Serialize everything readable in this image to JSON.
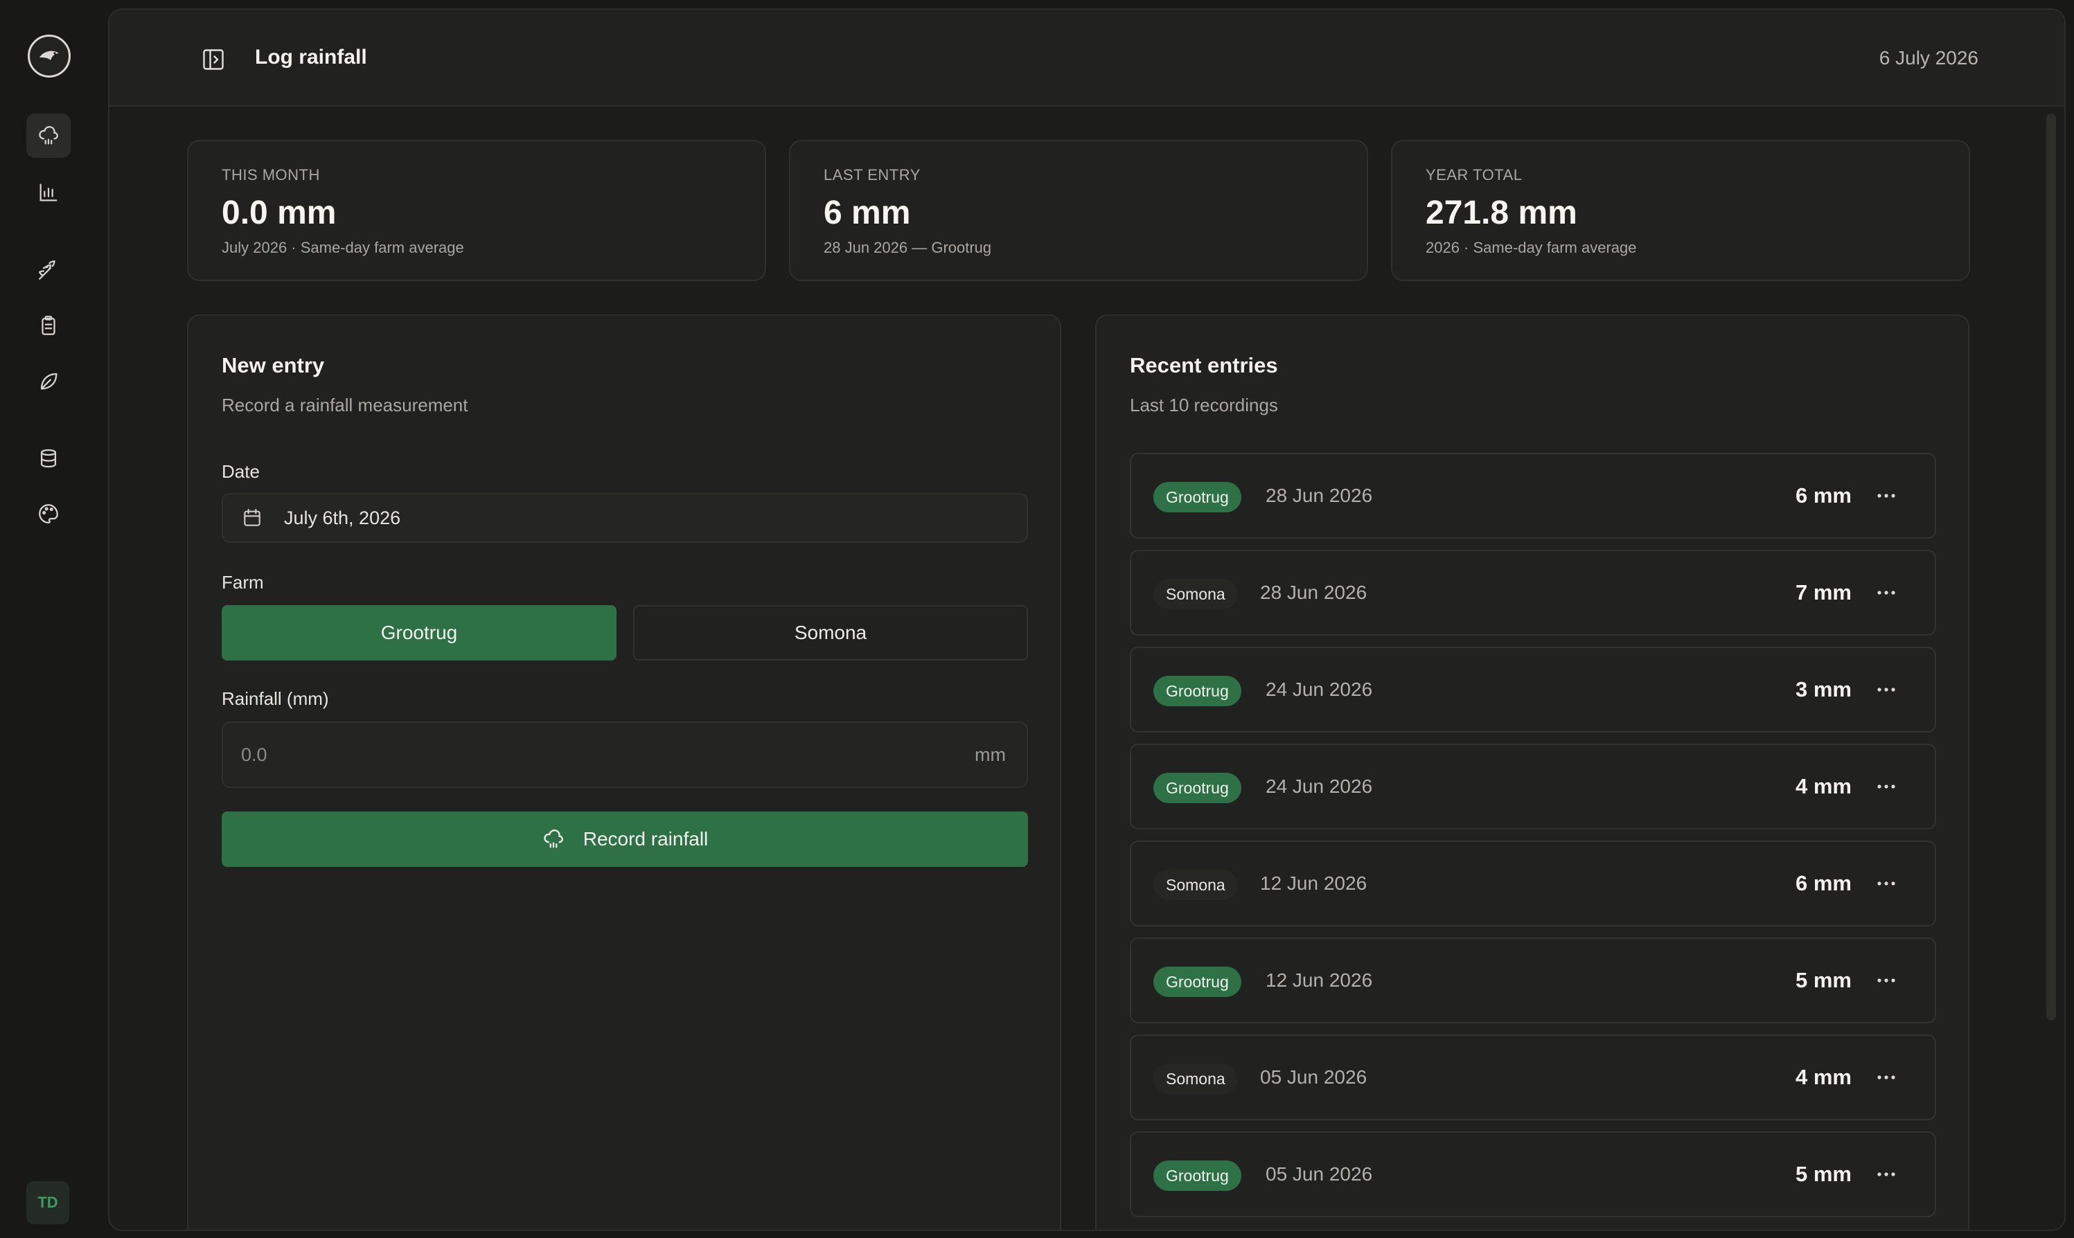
{
  "header": {
    "title": "Log rainfall",
    "date": "6 July 2026"
  },
  "user": {
    "initials": "TD"
  },
  "nav_icons": [
    "cloud-rain-icon",
    "bar-chart-icon",
    "wheat-icon",
    "clipboard-icon",
    "leaf-icon",
    "database-icon",
    "palette-icon"
  ],
  "stats": [
    {
      "label": "THIS MONTH",
      "value": "0.0 mm",
      "sub": "July 2026 · Same-day farm average"
    },
    {
      "label": "LAST ENTRY",
      "value": "6 mm",
      "sub": "28 Jun 2026 — Grootrug"
    },
    {
      "label": "YEAR TOTAL",
      "value": "271.8 mm",
      "sub": "2026 · Same-day farm average"
    }
  ],
  "new_entry": {
    "title": "New entry",
    "subtitle": "Record a rainfall measurement",
    "date_label": "Date",
    "date_value": "July 6th, 2026",
    "farm_label": "Farm",
    "farms": [
      "Grootrug",
      "Somona"
    ],
    "selected_farm": "Grootrug",
    "rain_label": "Rainfall (mm)",
    "rain_placeholder": "0.0",
    "rain_unit": "mm",
    "submit_label": "Record rainfall"
  },
  "recent": {
    "title": "Recent entries",
    "subtitle": "Last 10 recordings",
    "entries": [
      {
        "farm": "Grootrug",
        "date": "28 Jun 2026",
        "amount": "6 mm"
      },
      {
        "farm": "Somona",
        "date": "28 Jun 2026",
        "amount": "7 mm"
      },
      {
        "farm": "Grootrug",
        "date": "24 Jun 2026",
        "amount": "3 mm"
      },
      {
        "farm": "Grootrug",
        "date": "24 Jun 2026",
        "amount": "4 mm"
      },
      {
        "farm": "Somona",
        "date": "12 Jun 2026",
        "amount": "6 mm"
      },
      {
        "farm": "Grootrug",
        "date": "12 Jun 2026",
        "amount": "5 mm"
      },
      {
        "farm": "Somona",
        "date": "05 Jun 2026",
        "amount": "4 mm"
      },
      {
        "farm": "Grootrug",
        "date": "05 Jun 2026",
        "amount": "5 mm"
      }
    ]
  }
}
